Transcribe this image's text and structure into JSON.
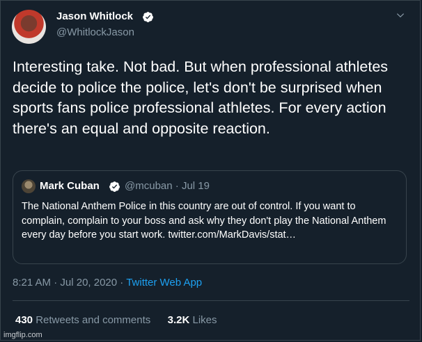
{
  "colors": {
    "background": "#15202b",
    "border": "#38444d",
    "muted": "#8899a6",
    "link": "#1da1f2"
  },
  "author": {
    "name": "Jason Whitlock",
    "handle": "@WhitlockJason",
    "avatar_icon": "avatar-icon"
  },
  "tweet": {
    "text": "Interesting take. Not bad. But when professional athletes decide to police the police, let's don't be surprised when sports fans police professional athletes. For every action there's an equal and opposite reaction."
  },
  "quote": {
    "name": "Mark Cuban",
    "handle": "@mcuban",
    "separator": "·",
    "date": "Jul 19",
    "text": "The National Anthem Police in this country are out of control. If you want to complain, complain to your boss and ask why they don't play the National Anthem every day before you start work.",
    "link": "twitter.com/MarkDavis/stat…"
  },
  "meta": {
    "time": "8:21 AM",
    "date": "Jul 20, 2020",
    "separator": "·",
    "source": "Twitter Web App"
  },
  "stats": {
    "retweets_count": "430",
    "retweets_label": "Retweets and comments",
    "likes_count": "3.2K",
    "likes_label": "Likes"
  },
  "watermark": "imgflip.com"
}
